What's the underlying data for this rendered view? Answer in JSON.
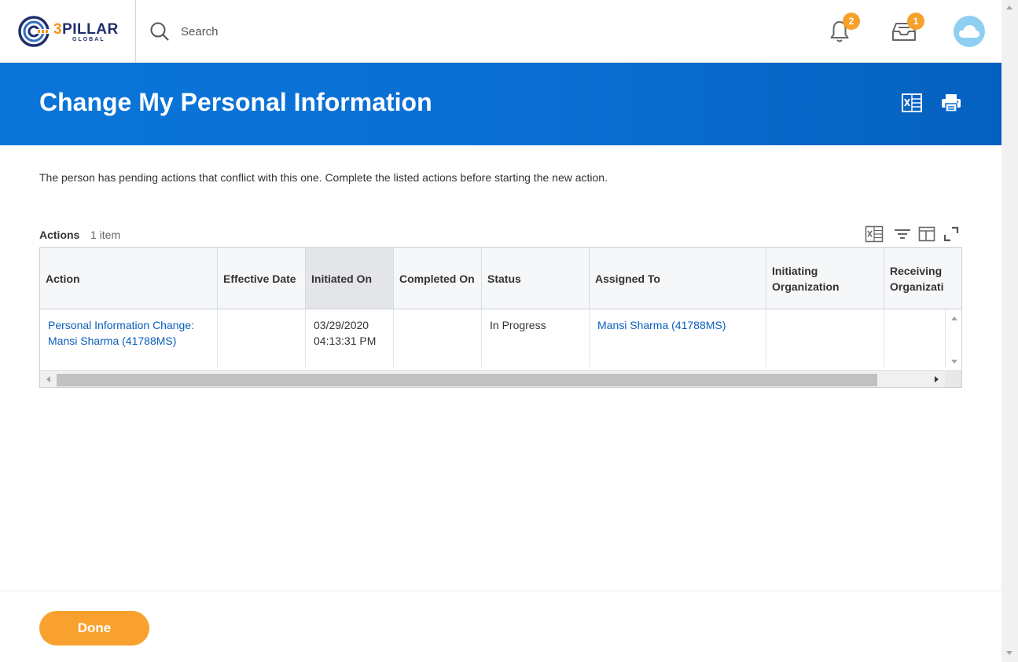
{
  "header": {
    "logo": {
      "brand": "3PILLAR",
      "brand_number": "3",
      "brand_word": "PILLAR",
      "tagline": "GLOBAL",
      "icon": "3pillar-logo-icon"
    },
    "search": {
      "placeholder": "Search",
      "icon": "search-icon"
    },
    "notifications": {
      "count": "2",
      "icon": "bell-icon"
    },
    "inbox": {
      "count": "1",
      "icon": "inbox-icon"
    },
    "avatar": {
      "icon": "cloud-icon",
      "color": "#8fd0f2"
    }
  },
  "banner": {
    "title": "Change My Personal Information",
    "export_icon": "excel-export-icon",
    "print_icon": "print-icon",
    "color": "#0a6fd4"
  },
  "message": "The person has pending actions that conflict with this one. Complete the listed actions before starting the new action.",
  "actions_table": {
    "label": "Actions",
    "count": "1 item",
    "toolbar_icons": [
      "excel-export-icon",
      "filter-icon",
      "column-layout-icon",
      "fullscreen-icon"
    ],
    "columns": [
      {
        "label": "Action"
      },
      {
        "label": "Effective Date"
      },
      {
        "label": "Initiated On",
        "sorted": true
      },
      {
        "label": "Completed On"
      },
      {
        "label": "Status"
      },
      {
        "label": "Assigned To"
      },
      {
        "label": "Initiating Organization",
        "line1": "Initiating",
        "line2": "Organization"
      },
      {
        "label": "Receiving Organization",
        "line1": "Receiving",
        "line2": "Organizati"
      }
    ],
    "rows": [
      {
        "action_line1": "Personal Information Change:",
        "action_line2": "Mansi Sharma (41788MS)",
        "effective_date": "",
        "initiated_date": "03/29/2020",
        "initiated_time": "04:13:31 PM",
        "completed_on": "",
        "status": "In Progress",
        "assigned_to": "Mansi Sharma (41788MS)",
        "initiating_org": "",
        "receiving_org": ""
      }
    ]
  },
  "footer": {
    "done_label": "Done",
    "done_color": "#f9a12e"
  }
}
